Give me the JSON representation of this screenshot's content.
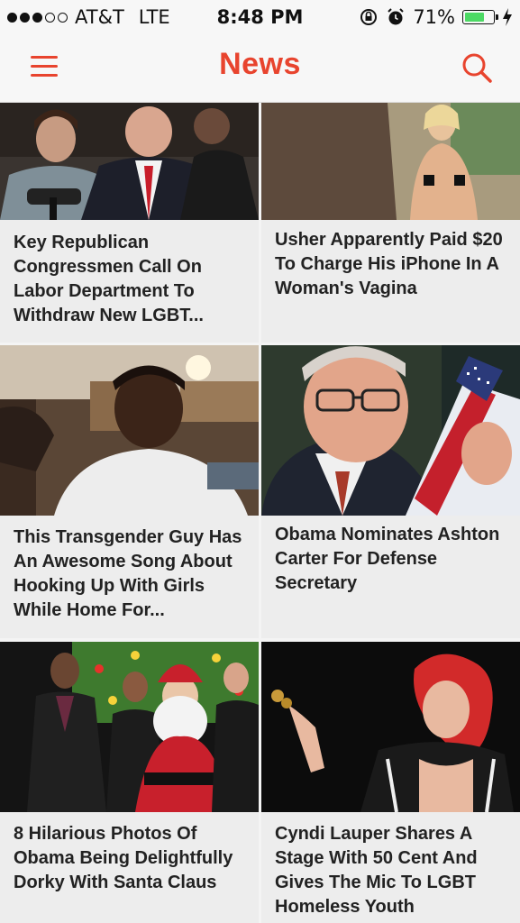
{
  "status_bar": {
    "carrier": "AT&T",
    "network": "LTE",
    "time": "8:48 PM",
    "battery": "71%",
    "battery_level": 0.71
  },
  "header": {
    "title": "News",
    "accent_color": "#e8442e"
  },
  "articles": [
    {
      "title": "Key Republican Congressmen Call On Labor Department To Withdraw New LGBT..."
    },
    {
      "title": "Usher Apparently Paid $20 To Charge His iPhone In A Woman's Vagina"
    },
    {
      "title": "This Transgender Guy Has An Awesome Song About Hooking Up With Girls While Home For..."
    },
    {
      "title": "Obama Nominates Ashton Carter For Defense Secretary"
    },
    {
      "title": "8 Hilarious Photos Of Obama Being Delightfully Dorky With Santa Claus"
    },
    {
      "title": "Cyndi Lauper Shares A Stage With 50 Cent And Gives The Mic To LGBT Homeless Youth"
    }
  ]
}
